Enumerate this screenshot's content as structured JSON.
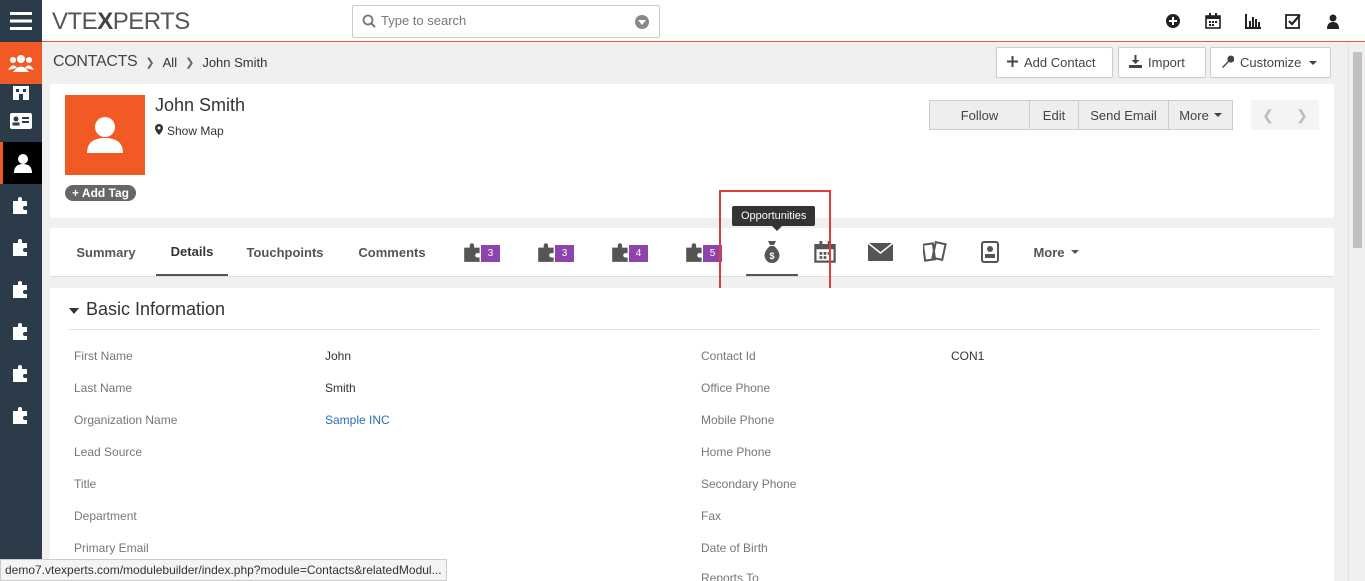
{
  "app": {
    "logo_left": "VTE",
    "logo_x": "X",
    "logo_right": "PERTS"
  },
  "search": {
    "placeholder": "Type to search"
  },
  "breadcrumb": {
    "module": "CONTACTS",
    "filter": "All",
    "record": "John Smith"
  },
  "header_buttons": {
    "add_contact": "Add Contact",
    "import": "Import",
    "customize": "Customize"
  },
  "record": {
    "name": "John Smith",
    "show_map": "Show Map",
    "add_tag": "+ Add Tag",
    "actions": {
      "follow": "Follow",
      "edit": "Edit",
      "send_email": "Send Email",
      "more": "More"
    }
  },
  "tabs": {
    "summary": "Summary",
    "details": "Details",
    "touchpoints": "Touchpoints",
    "comments": "Comments",
    "related": [
      {
        "icon": "puzzle-icon",
        "count": "3"
      },
      {
        "icon": "puzzle-icon",
        "count": "3"
      },
      {
        "icon": "puzzle-icon",
        "count": "4"
      },
      {
        "icon": "puzzle-icon",
        "count": "5"
      }
    ],
    "more": "More",
    "tooltip": "Opportunities"
  },
  "basic_info": {
    "title": "Basic Information",
    "left": [
      {
        "label": "First Name",
        "value": "John"
      },
      {
        "label": "Last Name",
        "value": "Smith"
      },
      {
        "label": "Organization Name",
        "value": "Sample INC"
      },
      {
        "label": "Lead Source",
        "value": ""
      },
      {
        "label": "Title",
        "value": ""
      },
      {
        "label": "Department",
        "value": ""
      },
      {
        "label": "Primary Email",
        "value": ""
      }
    ],
    "right": [
      {
        "label": "Contact Id",
        "value": "CON1"
      },
      {
        "label": "Office Phone",
        "value": ""
      },
      {
        "label": "Mobile Phone",
        "value": ""
      },
      {
        "label": "Home Phone",
        "value": ""
      },
      {
        "label": "Secondary Phone",
        "value": ""
      },
      {
        "label": "Fax",
        "value": ""
      },
      {
        "label": "Date of Birth",
        "value": ""
      },
      {
        "label": "Reports To",
        "value": ""
      }
    ]
  },
  "status_bar": {
    "url": "demo7.vtexperts.com/modulebuilder/index.php?module=Contacts&relatedModul..."
  },
  "colors": {
    "accent": "#f15a24",
    "rail": "#2c3b49",
    "badge": "#8e44ad",
    "highlight": "#e03c3c"
  }
}
